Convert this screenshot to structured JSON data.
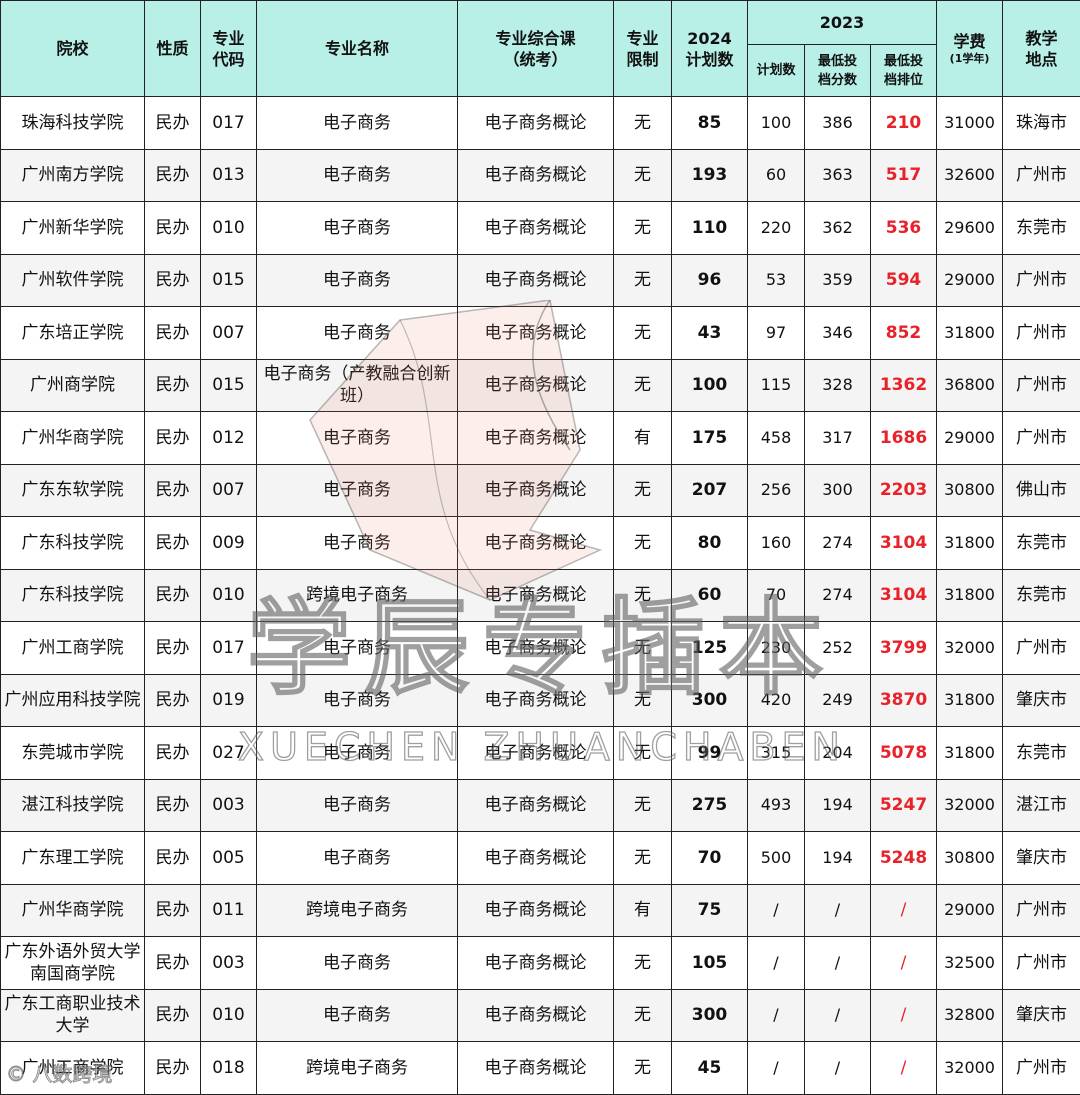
{
  "header": {
    "school": "院校",
    "nature": "性质",
    "code": "专业\n代码",
    "major": "专业名称",
    "course": "专业综合课\n（统考）",
    "limit": "专业\n限制",
    "plan2024": "2024\n计划数",
    "year2023": "2023",
    "plan2023": "计划数",
    "min_score": "最低投\n档分数",
    "min_rank": "最低投\n档排位",
    "tuition": "学费",
    "tuition_unit": "(1学年)",
    "location": "教学\n地点"
  },
  "rows": [
    {
      "school": "珠海科技学院",
      "nature": "民办",
      "code": "017",
      "major": "电子商务",
      "course": "电子商务概论",
      "limit": "无",
      "plan2024": "85",
      "plan2023": "100",
      "min_score": "386",
      "min_rank": "210",
      "tuition": "31000",
      "location": "珠海市"
    },
    {
      "school": "广州南方学院",
      "nature": "民办",
      "code": "013",
      "major": "电子商务",
      "course": "电子商务概论",
      "limit": "无",
      "plan2024": "193",
      "plan2023": "60",
      "min_score": "363",
      "min_rank": "517",
      "tuition": "32600",
      "location": "广州市"
    },
    {
      "school": "广州新华学院",
      "nature": "民办",
      "code": "010",
      "major": "电子商务",
      "course": "电子商务概论",
      "limit": "无",
      "plan2024": "110",
      "plan2023": "220",
      "min_score": "362",
      "min_rank": "536",
      "tuition": "29600",
      "location": "东莞市"
    },
    {
      "school": "广州软件学院",
      "nature": "民办",
      "code": "015",
      "major": "电子商务",
      "course": "电子商务概论",
      "limit": "无",
      "plan2024": "96",
      "plan2023": "53",
      "min_score": "359",
      "min_rank": "594",
      "tuition": "29000",
      "location": "广州市"
    },
    {
      "school": "广东培正学院",
      "nature": "民办",
      "code": "007",
      "major": "电子商务",
      "course": "电子商务概论",
      "limit": "无",
      "plan2024": "43",
      "plan2023": "97",
      "min_score": "346",
      "min_rank": "852",
      "tuition": "31800",
      "location": "广州市"
    },
    {
      "school": "广州商学院",
      "nature": "民办",
      "code": "015",
      "major": "电子商务（产教融合创新班）",
      "course": "电子商务概论",
      "limit": "无",
      "plan2024": "100",
      "plan2023": "115",
      "min_score": "328",
      "min_rank": "1362",
      "tuition": "36800",
      "location": "广州市"
    },
    {
      "school": "广州华商学院",
      "nature": "民办",
      "code": "012",
      "major": "电子商务",
      "course": "电子商务概论",
      "limit": "有",
      "plan2024": "175",
      "plan2023": "458",
      "min_score": "317",
      "min_rank": "1686",
      "tuition": "29000",
      "location": "广州市"
    },
    {
      "school": "广东东软学院",
      "nature": "民办",
      "code": "007",
      "major": "电子商务",
      "course": "电子商务概论",
      "limit": "无",
      "plan2024": "207",
      "plan2023": "256",
      "min_score": "300",
      "min_rank": "2203",
      "tuition": "30800",
      "location": "佛山市"
    },
    {
      "school": "广东科技学院",
      "nature": "民办",
      "code": "009",
      "major": "电子商务",
      "course": "电子商务概论",
      "limit": "无",
      "plan2024": "80",
      "plan2023": "160",
      "min_score": "274",
      "min_rank": "3104",
      "tuition": "31800",
      "location": "东莞市"
    },
    {
      "school": "广东科技学院",
      "nature": "民办",
      "code": "010",
      "major": "跨境电子商务",
      "course": "电子商务概论",
      "limit": "无",
      "plan2024": "60",
      "plan2023": "70",
      "min_score": "274",
      "min_rank": "3104",
      "tuition": "31800",
      "location": "东莞市"
    },
    {
      "school": "广州工商学院",
      "nature": "民办",
      "code": "017",
      "major": "电子商务",
      "course": "电子商务概论",
      "limit": "无",
      "plan2024": "125",
      "plan2023": "230",
      "min_score": "252",
      "min_rank": "3799",
      "tuition": "32000",
      "location": "广州市"
    },
    {
      "school": "广州应用科技学院",
      "nature": "民办",
      "code": "019",
      "major": "电子商务",
      "course": "电子商务概论",
      "limit": "无",
      "plan2024": "300",
      "plan2023": "420",
      "min_score": "249",
      "min_rank": "3870",
      "tuition": "31800",
      "location": "肇庆市"
    },
    {
      "school": "东莞城市学院",
      "nature": "民办",
      "code": "027",
      "major": "电子商务",
      "course": "电子商务概论",
      "limit": "无",
      "plan2024": "99",
      "plan2023": "315",
      "min_score": "204",
      "min_rank": "5078",
      "tuition": "31800",
      "location": "东莞市"
    },
    {
      "school": "湛江科技学院",
      "nature": "民办",
      "code": "003",
      "major": "电子商务",
      "course": "电子商务概论",
      "limit": "无",
      "plan2024": "275",
      "plan2023": "493",
      "min_score": "194",
      "min_rank": "5247",
      "tuition": "32000",
      "location": "湛江市"
    },
    {
      "school": "广东理工学院",
      "nature": "民办",
      "code": "005",
      "major": "电子商务",
      "course": "电子商务概论",
      "limit": "无",
      "plan2024": "70",
      "plan2023": "500",
      "min_score": "194",
      "min_rank": "5248",
      "tuition": "30800",
      "location": "肇庆市"
    },
    {
      "school": "广州华商学院",
      "nature": "民办",
      "code": "011",
      "major": "跨境电子商务",
      "course": "电子商务概论",
      "limit": "有",
      "plan2024": "75",
      "plan2023": "/",
      "min_score": "/",
      "min_rank": "/",
      "tuition": "29000",
      "location": "广州市"
    },
    {
      "school": "广东外语外贸大学南国商学院",
      "nature": "民办",
      "code": "003",
      "major": "电子商务",
      "course": "电子商务概论",
      "limit": "无",
      "plan2024": "105",
      "plan2023": "/",
      "min_score": "/",
      "min_rank": "/",
      "tuition": "32500",
      "location": "广州市"
    },
    {
      "school": "广东工商职业技术大学",
      "nature": "民办",
      "code": "010",
      "major": "电子商务",
      "course": "电子商务概论",
      "limit": "无",
      "plan2024": "300",
      "plan2023": "/",
      "min_score": "/",
      "min_rank": "/",
      "tuition": "32800",
      "location": "肇庆市"
    },
    {
      "school": "广州工商学院",
      "nature": "民办",
      "code": "018",
      "major": "跨境电子商务",
      "course": "电子商务概论",
      "limit": "无",
      "plan2024": "45",
      "plan2023": "/",
      "min_score": "/",
      "min_rank": "/",
      "tuition": "32000",
      "location": "广州市"
    }
  ],
  "watermark": {
    "main": "学辰专插本",
    "sub": "XUECHEN ZHUANCHABEN",
    "corner": "© 八数跨境"
  }
}
